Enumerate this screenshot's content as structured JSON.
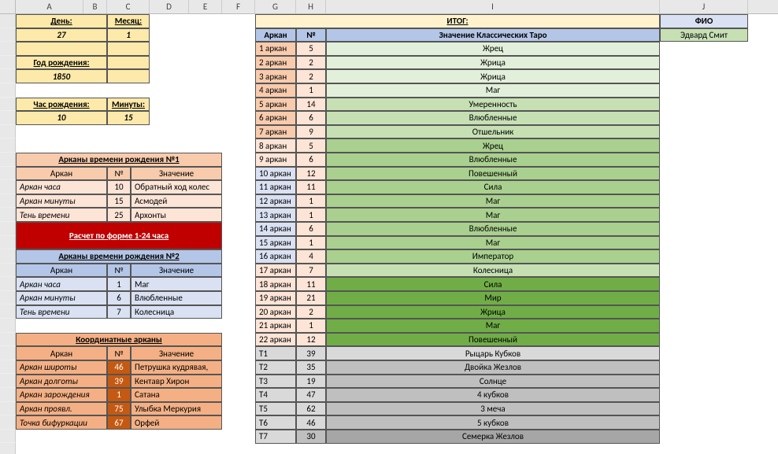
{
  "cols": [
    "A",
    "B",
    "C",
    "D",
    "E",
    "F",
    "G",
    "H",
    "I",
    "J"
  ],
  "day_label": "День:",
  "day_value": "27",
  "month_label": "Месяц:",
  "month_value": "1",
  "year_label": "Год рождения:",
  "year_value": "1850",
  "hour_label": "Час рождения:",
  "hour_value": "10",
  "min_label": "Минуты:",
  "min_value": "15",
  "arc1_title": "Арканы времени рождения №1",
  "arc1_h1": "Аркан",
  "arc1_h2": "№",
  "arc1_h3": "Значение",
  "arc1_rows": [
    {
      "a": "Аркан часа",
      "n": "10",
      "v": "Обратный ход колес"
    },
    {
      "a": "Аркан минуты",
      "n": "15",
      "v": "Асмодей"
    },
    {
      "a": "Тень времени",
      "n": "25",
      "v": "Архонты"
    }
  ],
  "red_title": "Расчет по форме 1-24 часа",
  "arc2_title": "Арканы времени рождения №2",
  "arc2_h1": "Аркан",
  "arc2_h2": "№",
  "arc2_h3": "Значение",
  "arc2_rows": [
    {
      "a": "Аркан часа",
      "n": "1",
      "v": "Маг"
    },
    {
      "a": "Аркан минуты",
      "n": "6",
      "v": "Влюбленные"
    },
    {
      "a": "Тень времени",
      "n": "7",
      "v": "Колесница"
    }
  ],
  "coord_title": "Координатные арканы",
  "coord_h1": "Аркан",
  "coord_h2": "№",
  "coord_h3": "Значение",
  "coord_rows": [
    {
      "a": "Аркан широты",
      "n": "46",
      "v": "Петрушка кудрявая,"
    },
    {
      "a": "Аркан долготы",
      "n": "39",
      "v": "Кентавр Хирон"
    },
    {
      "a": "Аркан зарождения",
      "n": "1",
      "v": "Сатана"
    },
    {
      "a": "Аркан проявл.",
      "n": "75",
      "v": "Улыбка Меркурия"
    },
    {
      "a": "Точка бифуркации",
      "n": "67",
      "v": "Орфей"
    }
  ],
  "itog": "ИТОГ:",
  "arcan_h": "Аркан",
  "num_h": "№",
  "znach_h": "Значение Классических Таро",
  "fio_h": "ФИО",
  "fio_v": "Эдвард Смит",
  "main_rows": [
    {
      "g": "1 аркан",
      "n": "5",
      "v": "Жрец",
      "cls": "grn1"
    },
    {
      "g": "2 аркан",
      "n": "2",
      "v": "Жрица",
      "cls": "grn1"
    },
    {
      "g": "3 аркан",
      "n": "2",
      "v": "Жрица",
      "cls": "grn1"
    },
    {
      "g": "4 аркан",
      "n": "1",
      "v": "Маг",
      "cls": "grn1"
    },
    {
      "g": "5 аркан",
      "n": "14",
      "v": "Умеренность",
      "cls": "grn2"
    },
    {
      "g": "6 аркан",
      "n": "6",
      "v": "Влюбленные",
      "cls": "grn2"
    },
    {
      "g": "7 аркан",
      "n": "9",
      "v": "Отшельник",
      "cls": "grn2"
    },
    {
      "g": "8 аркан",
      "n": "5",
      "v": "Жрец",
      "cls": "grn3"
    },
    {
      "g": "9 аркан",
      "n": "6",
      "v": "Влюбленные",
      "cls": "grn3"
    },
    {
      "g": "10 аркан",
      "n": "12",
      "v": "Повешенный",
      "cls": "grn3"
    },
    {
      "g": "11 аркан",
      "n": "11",
      "v": "Сила",
      "cls": "grn3"
    },
    {
      "g": "12 аркан",
      "n": "1",
      "v": "Маг",
      "cls": "grn3"
    },
    {
      "g": "13 аркан",
      "n": "1",
      "v": "Маг",
      "cls": "grn3"
    },
    {
      "g": "14 аркан",
      "n": "6",
      "v": "Влюбленные",
      "cls": "grn3"
    },
    {
      "g": "15 аркан",
      "n": "1",
      "v": "Маг",
      "cls": "grn3"
    },
    {
      "g": "16 аркан",
      "n": "4",
      "v": "Император",
      "cls": "grn3"
    },
    {
      "g": "17 аркан",
      "n": "7",
      "v": "Колесница",
      "cls": "grn2"
    },
    {
      "g": "18 аркан",
      "n": "11",
      "v": "Сила",
      "cls": "grn4"
    },
    {
      "g": "19 аркан",
      "n": "21",
      "v": "Мир",
      "cls": "grn4"
    },
    {
      "g": "20 аркан",
      "n": "2",
      "v": "Жрица",
      "cls": "grn4"
    },
    {
      "g": "21 аркан",
      "n": "1",
      "v": "Маг",
      "cls": "grn4"
    },
    {
      "g": "22 аркан",
      "n": "12",
      "v": "Повешенный",
      "cls": "grn4"
    },
    {
      "g": "Т1",
      "n": "39",
      "v": "Рыцарь Кубков",
      "cls": "gray1",
      "gcls": "gray1"
    },
    {
      "g": "Т2",
      "n": "35",
      "v": "Двойка Жезлов",
      "cls": "gray2",
      "gcls": "gray1"
    },
    {
      "g": "Т3",
      "n": "19",
      "v": "Солнце",
      "cls": "gray2",
      "gcls": "gray1"
    },
    {
      "g": "Т4",
      "n": "47",
      "v": "4 кубков",
      "cls": "gray2",
      "gcls": "gray1"
    },
    {
      "g": "Т5",
      "n": "62",
      "v": "3 меча",
      "cls": "gray2",
      "gcls": "gray1"
    },
    {
      "g": "Т6",
      "n": "46",
      "v": "5 кубков",
      "cls": "gray2",
      "gcls": "gray1"
    },
    {
      "g": "Т7",
      "n": "30",
      "v": "Семерка Жезлов",
      "cls": "gray3",
      "gcls": "gray1"
    }
  ]
}
